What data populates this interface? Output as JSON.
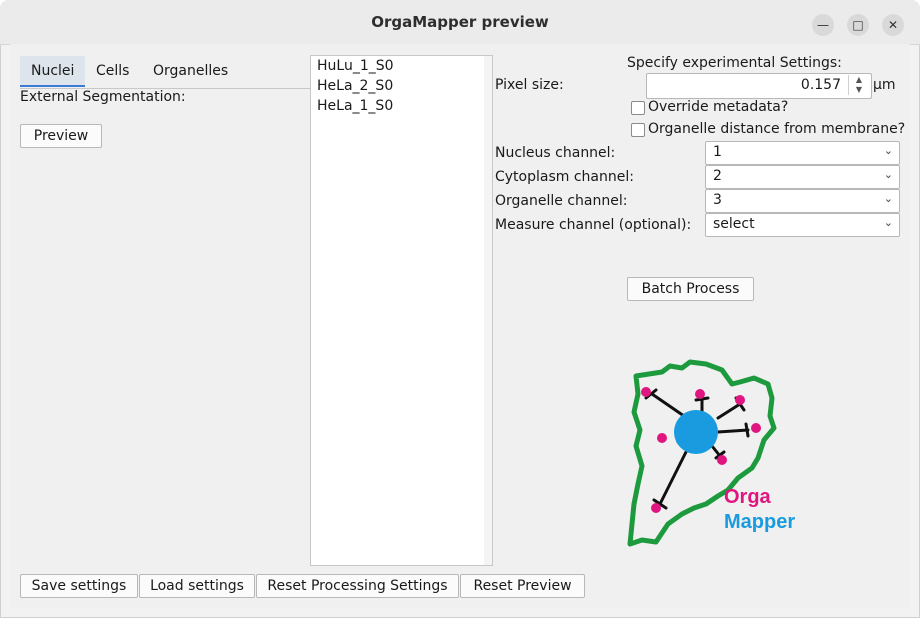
{
  "window": {
    "title": "OrgaMapper preview",
    "controls": [
      "minimize-icon",
      "maximize-icon",
      "close-icon"
    ]
  },
  "tabs": [
    "Nuclei",
    "Cells",
    "Organelles"
  ],
  "left_panel": {
    "external_segmentation_label": "External Segmentation:",
    "preview_button": "Preview"
  },
  "file_list": [
    "HuLu_1_S0",
    "HeLa_2_S0",
    "HeLa_1_S0"
  ],
  "settings": {
    "header": "Specify experimental Settings:",
    "pixel_size_label": "Pixel size:",
    "pixel_size_value": "0.157",
    "pixel_size_unit": "µm",
    "override_metadata_label": "Override metadata?",
    "override_metadata_checked": false,
    "organelle_distance_label": "Organelle distance from membrane?",
    "organelle_distance_checked": false,
    "nucleus_channel_label": "Nucleus channel:",
    "nucleus_channel_value": "1",
    "cytoplasm_channel_label": "Cytoplasm channel:",
    "cytoplasm_channel_value": "2",
    "organelle_channel_label": "Organelle channel:",
    "organelle_channel_value": "3",
    "measure_channel_label": "Measure channel (optional):",
    "measure_channel_value": "select",
    "batch_process_button": "Batch Process"
  },
  "logo": {
    "text_line1": "Orga",
    "text_line2": "Mapper",
    "colors": {
      "cell_outline": "#1e9a3e",
      "nucleus": "#1a9be0",
      "organelle": "#e0157f",
      "orga_text": "#e0157f",
      "mapper_text": "#1a9be0"
    }
  },
  "bottom_buttons": {
    "save": "Save settings",
    "load": "Load settings",
    "reset_processing": "Reset Processing Settings",
    "reset_preview": "Reset Preview"
  }
}
